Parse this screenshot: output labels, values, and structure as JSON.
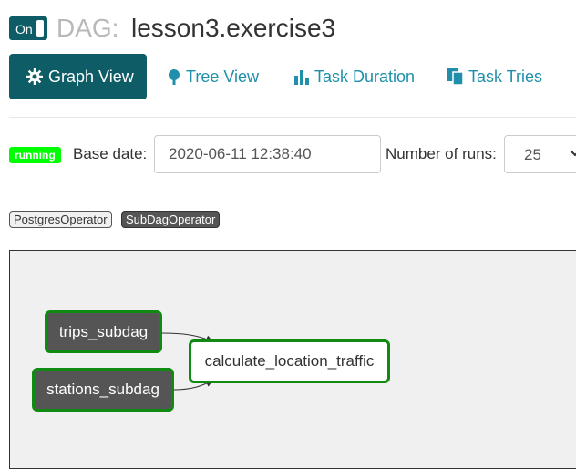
{
  "header": {
    "toggle_label": "On",
    "dag_prefix": "DAG:",
    "dag_id": "lesson3.exercise3"
  },
  "tabs": [
    {
      "label": "Graph View",
      "icon": "gear-icon",
      "active": true
    },
    {
      "label": "Tree View",
      "icon": "tree-icon",
      "active": false
    },
    {
      "label": "Task Duration",
      "icon": "bar-chart-icon",
      "active": false
    },
    {
      "label": "Task Tries",
      "icon": "files-icon",
      "active": false
    }
  ],
  "controls": {
    "status": "running",
    "base_date_label": "Base date:",
    "base_date_value": "2020-06-11 12:38:40",
    "num_runs_label": "Number of runs:",
    "num_runs_value": "25"
  },
  "operators": [
    "PostgresOperator",
    "SubDagOperator"
  ],
  "graph": {
    "nodes": [
      {
        "label": "trips_subdag",
        "type": "SubDagOperator"
      },
      {
        "label": "stations_subdag",
        "type": "SubDagOperator"
      },
      {
        "label": "calculate_location_traffic",
        "type": "PostgresOperator"
      }
    ]
  },
  "colors": {
    "primary": "#0e5c66",
    "link": "#1f8fab",
    "running": "#00ff00",
    "node_border": "#118a11",
    "subdag_fill": "#555555"
  }
}
